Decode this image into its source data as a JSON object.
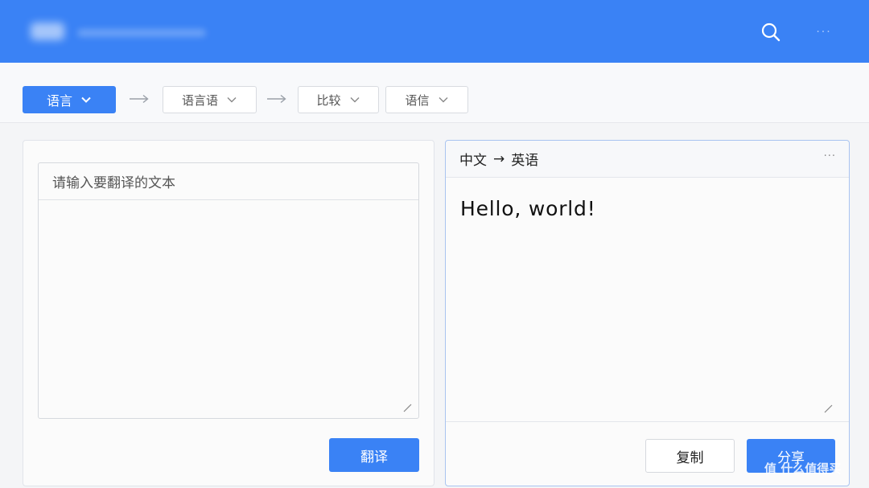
{
  "header": {
    "search_icon": "search-icon",
    "more_label": "···"
  },
  "toolbar": {
    "selects": [
      {
        "label": "语言"
      },
      {
        "label": "语言语"
      },
      {
        "label": "比较"
      },
      {
        "label": "语信"
      }
    ]
  },
  "left_panel": {
    "input_placeholder": "请输入要翻译的文本",
    "translate_label": "翻译"
  },
  "right_panel": {
    "source_lang": "中文",
    "arrow": "→",
    "target_lang": "英语",
    "more_label": "···",
    "result": "Hello, world!",
    "copy_label": "复制",
    "share_label": "分享"
  },
  "watermark": {
    "text": "值 什么值得买"
  },
  "colors": {
    "primary": "#3a82f5",
    "background": "#f4f5f7"
  }
}
